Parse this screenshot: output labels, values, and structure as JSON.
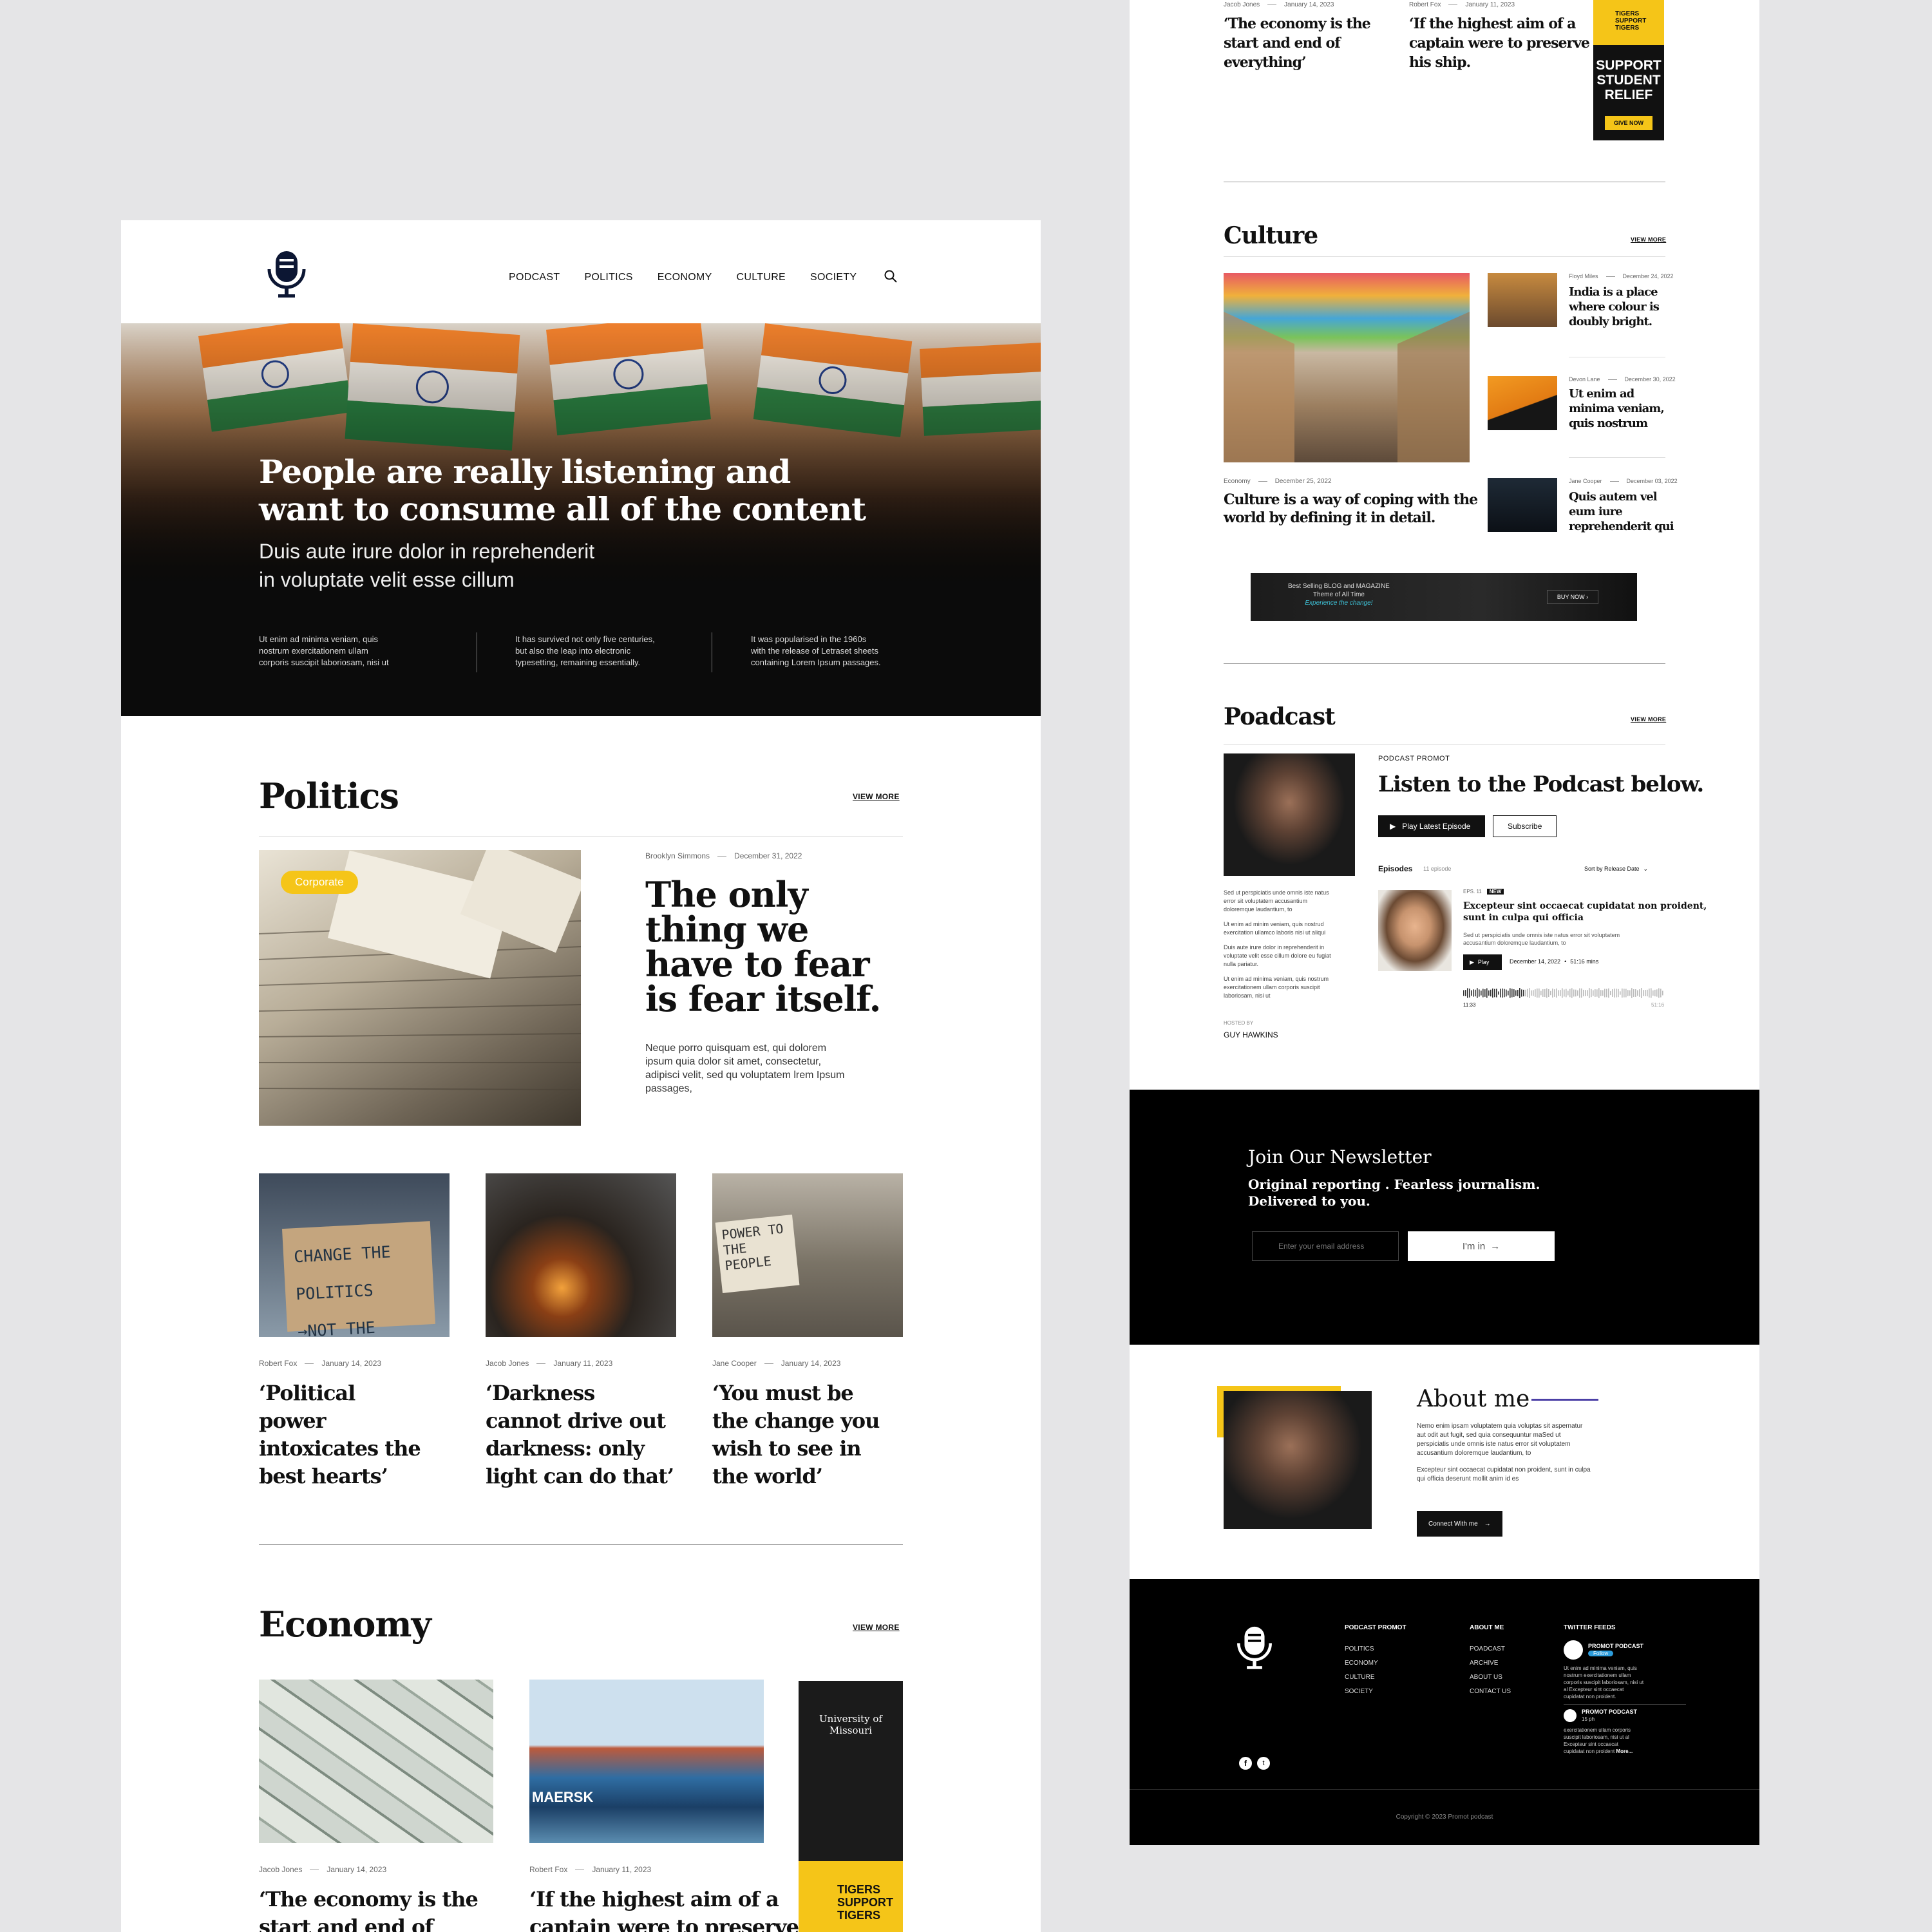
{
  "brand": {
    "mic_icon": "microphone-icon"
  },
  "nav": {
    "items": [
      "PODCAST",
      "POLITICS",
      "ECONOMY",
      "CULTURE",
      "SOCIETY"
    ],
    "search_icon": "search-icon"
  },
  "hero": {
    "title_1": "People are really listening and",
    "title_2": "want to consume all of the content",
    "sub_1": "Duis aute irure dolor in reprehenderit",
    "sub_2": "in voluptate velit esse cillum",
    "cols": [
      [
        "Ut enim ad minima veniam, quis",
        "nostrum exercitationem ullam",
        "corporis suscipit laboriosam, nisi ut"
      ],
      [
        "It has survived not only five centuries,",
        "but also the leap into electronic",
        "typesetting, remaining essentially."
      ],
      [
        "It was popularised in the 1960s",
        "with the release of Letraset sheets",
        "containing Lorem Ipsum passages."
      ]
    ]
  },
  "politics": {
    "title": "Politics",
    "view_more": "VIEW MORE",
    "tag": "Corporate",
    "author": "Brooklyn Simmons",
    "date": "December 31, 2022",
    "headline": [
      "The only",
      "thing we",
      "have to fear",
      "is fear itself."
    ],
    "body": [
      "Neque porro quisquam est, qui dolorem",
      "ipsum quia dolor sit amet, consectetur,",
      "adipisci velit, sed qu voluptatem  lrem Ipsum",
      "passages,"
    ],
    "cards": [
      {
        "author": "Robert Fox",
        "date": "January 14, 2023",
        "title": [
          "‘Political",
          "power",
          "intoxicates the",
          "best hearts’"
        ],
        "sign_1": "CHANGE THE POLITICS",
        "sign_2": "→NOT THE CLIMATE"
      },
      {
        "author": "Jacob Jones",
        "date": "January 11, 2023",
        "title": [
          "‘Darkness",
          "cannot drive out",
          "darkness: only",
          "light can do that’"
        ]
      },
      {
        "author": "Jane Cooper",
        "date": "January 14, 2023",
        "title": [
          "‘You must be",
          "the change you",
          "wish to see in",
          "the world’"
        ],
        "sign": "POWER TO THE PEOPLE"
      }
    ]
  },
  "economy": {
    "title": "Economy",
    "view_more": "VIEW MORE",
    "cards": [
      {
        "author": "Jacob Jones",
        "date": "January 14, 2023",
        "title": [
          "‘The economy is the",
          "start and end of"
        ]
      },
      {
        "author": "Robert Fox",
        "date": "January 11, 2023",
        "title": [
          "‘If the highest aim of a",
          "captain were to preserve"
        ]
      }
    ],
    "ad": {
      "univ": "University of Missouri",
      "tigers": "TIGERS SUPPORT TIGERS"
    },
    "ship_label": "MAERSK"
  },
  "right_top": {
    "cards": [
      {
        "author": "Jacob Jones",
        "date": "January 14, 2023",
        "title": [
          "‘The economy is the",
          "start and end of",
          "everything’"
        ]
      },
      {
        "author": "Robert Fox",
        "date": "January 11, 2023",
        "title": [
          "‘If the highest aim of a",
          "captain were to preserve",
          "his ship."
        ]
      }
    ],
    "ad": {
      "tigers": "TIGERS SUPPORT TIGERS",
      "support": [
        "SUPPORT",
        "STUDENT",
        "RELIEF"
      ],
      "give": "GIVE NOW"
    }
  },
  "culture": {
    "title": "Culture",
    "view_more": "VIEW MORE",
    "main": {
      "category": "Economy",
      "date": "December 25, 2022",
      "title": [
        "Culture is a way of coping with the",
        "world by defining it in detail."
      ]
    },
    "side": [
      {
        "author": "Floyd Miles",
        "date": "December 24, 2022",
        "title": [
          "India is a place",
          "where colour is",
          "doubly bright."
        ]
      },
      {
        "author": "Devon Lane",
        "date": "December 30, 2022",
        "title": [
          "Ut enim ad",
          "minima veniam,",
          "quis nostrum"
        ]
      },
      {
        "author": "Jane Cooper",
        "date": "December 03, 2022",
        "title": [
          "Quis autem vel",
          "eum iure",
          "reprehenderit qui"
        ]
      }
    ],
    "banner": {
      "line1": "Best Selling BLOG and MAGAZINE",
      "line2": "Theme of All Time",
      "line3": "Experience the change!",
      "cta": "BUY NOW ›"
    }
  },
  "podcast": {
    "title": "Poadcast",
    "view_more": "VIEW MORE",
    "promo": "PODCAST PROMOT",
    "headline": "Listen to the Podcast below.",
    "play": "Play Latest Episode",
    "subscribe": "Subscribe",
    "episodes": "Episodes",
    "ep_count": "11 episode",
    "sort": "Sort by Release Date",
    "bio": [
      [
        "Sed ut perspiciatis unde omnis iste natus",
        "error sit voluptatem accusantium",
        "doloremque laudantium, to"
      ],
      [
        "Ut enim ad minim veniam, quis nostrud",
        "exercitation ullamco laboris nisi ut aliqui"
      ],
      [
        "Duis aute irure dolor in reprehenderit in",
        "voluptate velit esse cillum dolore eu fugiat",
        "nulla pariatur."
      ],
      [
        "Ut enim ad minima veniam, quis nostrum",
        "exercitationem ullam corporis suscipit",
        "laboriosam, nisi ut"
      ]
    ],
    "hosted_by": "HOSTED BY",
    "host": "GUY HAWKINS",
    "ep": {
      "num": "EPS. 11",
      "badge": "NEW",
      "title": [
        "Excepteur sint occaecat cupidatat non proident,",
        "sunt in culpa qui officia"
      ],
      "desc": [
        "Sed ut perspiciatis unde omnis iste natus error sit voluptatem",
        "accusantium doloremque laudantium, to"
      ],
      "play": "Play",
      "date": "December 14, 2022",
      "duration": "51:16 mins",
      "elapsed": "11:33",
      "total": "51:16",
      "progress": 0.3
    }
  },
  "newsletter": {
    "title": "Join Our Newsletter",
    "sub_1": "Original reporting . Fearless journalism.",
    "sub_2": "Delivered to you.",
    "placeholder": "Enter your email address",
    "cta": "I'm in"
  },
  "about": {
    "title": "About me",
    "p1": [
      "Nemo enim ipsam voluptatem quia voluptas sit aspernatur",
      "aut odit aut fugit, sed quia consequuntur maSed ut",
      "perspiciatis unde omnis iste natus error sit voluptatem",
      "accusantium doloremque laudantium, to"
    ],
    "p2": [
      "Excepteur sint occaecat cupidatat non proident, sunt in culpa",
      "qui officia deserunt mollit anim id es"
    ],
    "cta": "Connect With me"
  },
  "footer": {
    "col1": {
      "title": "PODCAST PROMOT",
      "items": [
        "POLITICS",
        "ECONOMY",
        "CULTURE",
        "SOCIETY"
      ]
    },
    "col2": {
      "title": "ABOUT ME",
      "items": [
        "POADCAST",
        "ARCHIVE",
        "ABOUT US",
        "CONTACT US"
      ]
    },
    "col3": {
      "title": "TWITTER FEEDS",
      "t1": {
        "name": "PROMOT PODCAST",
        "follow": "Follow",
        "text": [
          "Ut enim ad minima veniam, quis",
          "nostrum exercitationem ullam",
          "corporis suscipit laboriosam, nisi ut",
          "al Excepteur sint occaecat",
          "cupidatat non proident."
        ]
      },
      "t2": {
        "name": "PROMOT PODCAST",
        "handle": "15 ph",
        "text": [
          "exercitationem ullam corporis",
          "suscipit laboriosam, nisi ut al",
          "Excepteur sint occaecat",
          "cupidatat non proident"
        ],
        "more": "More..."
      }
    },
    "copyright": "Copyright © 2023 Promot podcast",
    "social": [
      "facebook-icon",
      "twitter-icon"
    ]
  }
}
